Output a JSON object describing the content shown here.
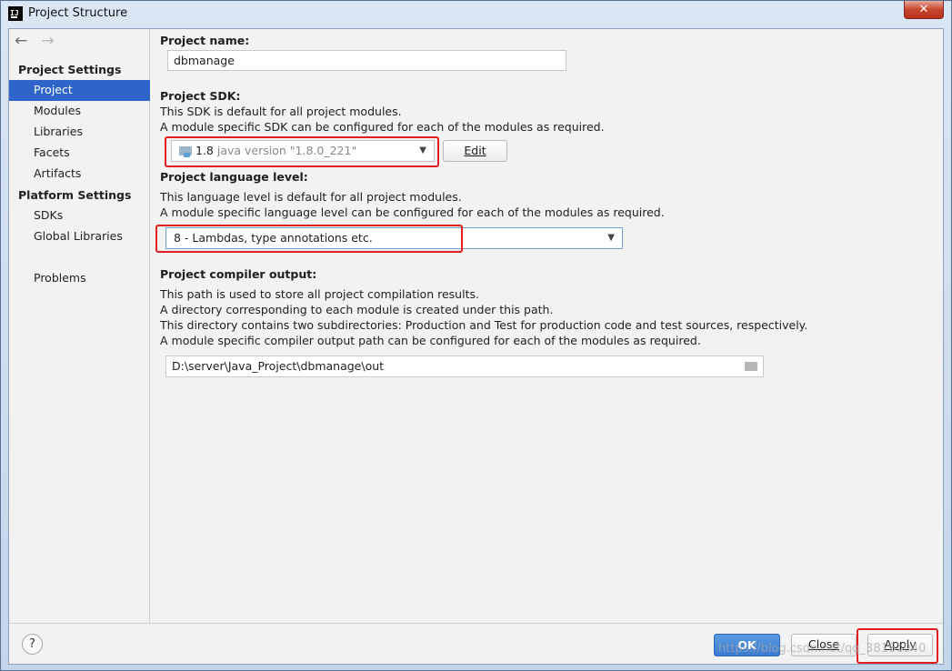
{
  "window": {
    "title": "Project Structure",
    "app_icon_text": "IJ",
    "close_symbol": "✕"
  },
  "sidebar": {
    "back_arrow": "←",
    "forward_arrow": "→",
    "project_settings_header": "Project Settings",
    "project_settings_items": [
      {
        "label": "Project",
        "selected": true
      },
      {
        "label": "Modules"
      },
      {
        "label": "Libraries"
      },
      {
        "label": "Facets"
      },
      {
        "label": "Artifacts"
      }
    ],
    "platform_settings_header": "Platform Settings",
    "platform_settings_items": [
      {
        "label": "SDKs"
      },
      {
        "label": "Global Libraries"
      }
    ],
    "problems_label": "Problems"
  },
  "project_name": {
    "label": "Project name:",
    "value": "dbmanage"
  },
  "project_sdk": {
    "label": "Project SDK:",
    "desc_1": "This SDK is default for all project modules.",
    "desc_2": "A module specific SDK can be configured for each of the modules as required.",
    "selected_name": "1.8",
    "selected_version": "java version \"1.8.0_221\"",
    "edit_button": "Edit"
  },
  "language_level": {
    "label": "Project language level:",
    "desc_1": "This language level is default for all project modules.",
    "desc_2": "A module specific language level can be configured for each of the modules as required.",
    "selected": "8 - Lambdas, type annotations etc."
  },
  "compiler_output": {
    "label": "Project compiler output:",
    "desc_1": "This path is used to store all project compilation results.",
    "desc_2": "A directory corresponding to each module is created under this path.",
    "desc_3": "This directory contains two subdirectories: Production and Test for production code and test sources, respectively.",
    "desc_4": "A module specific compiler output path can be configured for each of the modules as required.",
    "path": "D:\\server\\Java_Project\\dbmanage\\out"
  },
  "footer": {
    "help_label": "?",
    "ok_label": "OK",
    "close_label": "Close",
    "apply_label": "Apply",
    "watermark": "https://blog.csdn.net/qq_38161040"
  },
  "colors": {
    "selection": "#2f65ca",
    "highlight_box": "#e02020",
    "ok_button": "#3a7bd0"
  }
}
